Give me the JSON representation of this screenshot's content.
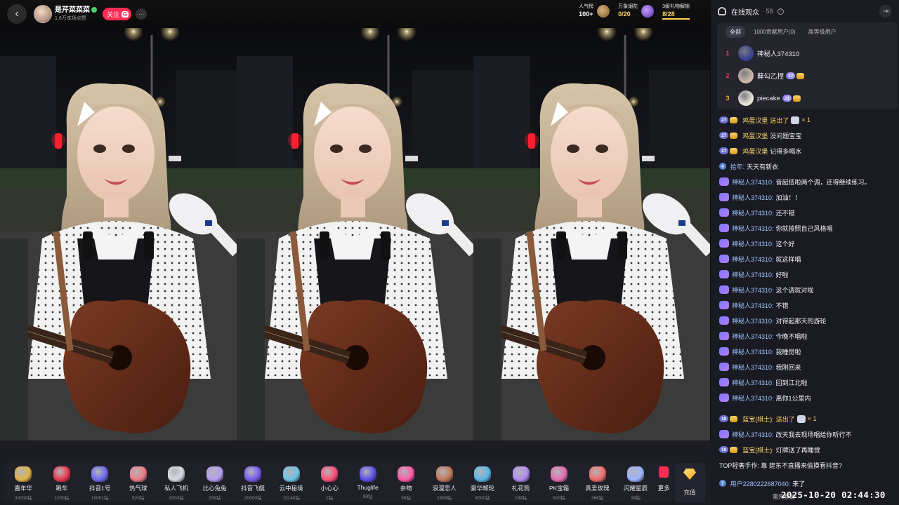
{
  "header": {
    "host_name": "是芹菜菜菜",
    "host_sub": "1.6万本场点赞",
    "follow_label": "关注",
    "fan_badge": "G",
    "stats": [
      {
        "label": "人气榜",
        "value": "100+"
      },
      {
        "label": "万象烟花",
        "value": "0/20"
      },
      {
        "label": "3级礼物解锁",
        "value": "8/28"
      }
    ]
  },
  "gifts": [
    {
      "name": "嘉年华",
      "price": "30000钻",
      "color": "#e3b24a"
    },
    {
      "name": "跑车",
      "price": "1200钻",
      "color": "#e83a4f"
    },
    {
      "name": "抖音1号",
      "price": "10001钻",
      "color": "#6f6bf0"
    },
    {
      "name": "热气球",
      "price": "520钻",
      "color": "#f07a86"
    },
    {
      "name": "私人飞机",
      "price": "3000钻",
      "color": "#d8dbe6"
    },
    {
      "name": "比心兔兔",
      "price": "299钻",
      "color": "#b49cf0"
    },
    {
      "name": "抖音飞艇",
      "price": "20000钻",
      "color": "#7a5cf0"
    },
    {
      "name": "云中秘境",
      "price": "13140钻",
      "color": "#6ec3e8"
    },
    {
      "name": "小心心",
      "price": "1钻",
      "color": "#ff4f7a"
    },
    {
      "name": "Thuglife",
      "price": "99钻",
      "color": "#5b4ee8"
    },
    {
      "name": "亲吻",
      "price": "99钻",
      "color": "#ff5aa8"
    },
    {
      "name": "浪漫恋人",
      "price": "1999钻",
      "color": "#c47a5a"
    },
    {
      "name": "豪华邮轮",
      "price": "6000钻",
      "color": "#58b8e8"
    },
    {
      "name": "礼花筒",
      "price": "199钻",
      "color": "#b28cf5"
    },
    {
      "name": "PK宝箱",
      "price": "600钻",
      "color": "#e36fb3"
    },
    {
      "name": "真爱玫瑰",
      "price": "366钻",
      "color": "#f06a6a"
    },
    {
      "name": "闪耀星辰",
      "price": "99钻",
      "color": "#9bb4ff"
    }
  ],
  "more_label": "更多",
  "recharge_label": "充值",
  "side": {
    "title": "在线观众",
    "count": "· 58",
    "tabs": [
      "全部",
      "1000贡献用户(0)",
      "高等级用户"
    ],
    "ranking": [
      {
        "rank": "1",
        "name": "神秘人374310",
        "level": "",
        "avatar": "#3a3f8f"
      },
      {
        "rank": "2",
        "name": "藓勾乙捏",
        "level": "27",
        "avatar": "#c9b6a6"
      },
      {
        "rank": "3",
        "name": "piecake",
        "level": "21",
        "avatar": "#e9e3da"
      }
    ]
  },
  "chat": [
    {
      "type": "gift",
      "level": "27",
      "nick": "鸡蛋汉堡",
      "text": "送出了",
      "gift_count": "× 1"
    },
    {
      "type": "fan",
      "level": "27",
      "nick": "鸡蛋汉堡",
      "text": "没问题宝宝"
    },
    {
      "type": "fan",
      "level": "27",
      "nick": "鸡蛋汉堡",
      "text": "记得多喝水"
    },
    {
      "type": "fan4",
      "level": "4",
      "nick": "拾年",
      "text": "天天有新衣"
    },
    {
      "type": "anon",
      "nick": "神秘人374310",
      "text": "音起低啦两个调，还得继续练习。"
    },
    {
      "type": "anon",
      "nick": "神秘人374310",
      "text": "加油！！"
    },
    {
      "type": "anon",
      "nick": "神秘人374310",
      "text": "还不错"
    },
    {
      "type": "anon",
      "nick": "神秘人374310",
      "text": "你就按照自己风格唱"
    },
    {
      "type": "anon",
      "nick": "神秘人374310",
      "text": "这个好"
    },
    {
      "type": "anon",
      "nick": "神秘人374310",
      "text": "就这样唱"
    },
    {
      "type": "anon",
      "nick": "神秘人374310",
      "text": "好啦"
    },
    {
      "type": "anon",
      "nick": "神秘人374310",
      "text": "这个调就对啦"
    },
    {
      "type": "anon",
      "nick": "神秘人374310",
      "text": "不错"
    },
    {
      "type": "anon",
      "nick": "神秘人374310",
      "text": "对得起那天的游轮"
    },
    {
      "type": "anon",
      "nick": "神秘人374310",
      "text": "今晚不唱啦"
    },
    {
      "type": "anon",
      "nick": "神秘人374310",
      "text": "我睡觉啦"
    },
    {
      "type": "anon",
      "nick": "神秘人374310",
      "text": "我刚回来"
    },
    {
      "type": "anon",
      "nick": "神秘人374310",
      "text": "回到江北啦"
    },
    {
      "type": "anon",
      "nick": "神秘人374310",
      "text": "离你1公里内"
    },
    {
      "type": "gift",
      "level": "19",
      "nick": "蓝宝(棋士):",
      "text": "送出了",
      "gift_count": "× 1"
    },
    {
      "type": "anon",
      "nick": "神秘人374310",
      "text": "改天我去现场唱给你听行不"
    },
    {
      "type": "fan",
      "level": "19",
      "nick": "蓝宝(棋士):",
      "text": "灯牌送了再睡觉"
    },
    {
      "type": "notice",
      "text": "TOP轻奢手作: 靠 建东不直播来偷摸看抖音?"
    },
    {
      "type": "enter",
      "level": "7",
      "nick": "用户2280222687040",
      "text": "来了"
    }
  ],
  "footer": {
    "status": "需先登录",
    "timestamp": "2025-10-20 02:44:30"
  }
}
